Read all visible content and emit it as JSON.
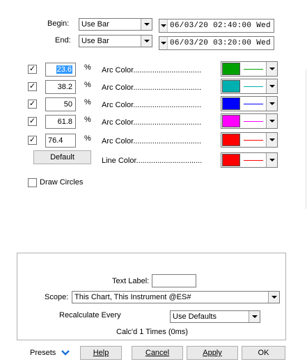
{
  "time_range": {
    "begin_label": "Begin:",
    "end_label": "End:",
    "begin_value": "Use Bar",
    "end_value": "Use Bar",
    "begin_datetime": "06/03/20 02:40:00 Wed",
    "end_datetime": "06/03/20 03:20:00 Wed"
  },
  "levels": [
    {
      "checked": true,
      "value": "23.6",
      "pct": "%",
      "label": "Arc Color................................",
      "color": "#00a000",
      "line_color": "#00a000"
    },
    {
      "checked": true,
      "value": "38.2",
      "pct": "%",
      "label": "Arc Color................................",
      "color": "#00b0b0",
      "line_color": "#00b0b0"
    },
    {
      "checked": true,
      "value": "50",
      "pct": "%",
      "label": "Arc Color................................",
      "color": "#0000ff",
      "line_color": "#0000ff"
    },
    {
      "checked": true,
      "value": "61.8",
      "pct": "%",
      "label": "Arc Color................................",
      "color": "#ff00ff",
      "line_color": "#ff00ff"
    },
    {
      "checked": true,
      "value": "76.4",
      "pct": "%",
      "label": "Arc Color................................",
      "color": "#ff0000",
      "line_color": "#ff0000"
    }
  ],
  "default_button": "Default",
  "line_color": {
    "label": "Line Color...............................",
    "color": "#ff0000",
    "line_color": "#ff0000"
  },
  "draw_circles": {
    "checked": false,
    "label": "Draw Circles"
  },
  "footer": {
    "text_label": "Text Label:",
    "text_value": "",
    "scope_label": "Scope:",
    "scope_value": "This Chart, This Instrument @ES#",
    "recalc_label": "Recalculate Every",
    "recalc_value": "Use Defaults",
    "calc_status": "Calc'd 1 Times (0ms)"
  },
  "buttons": {
    "presets": "Presets",
    "help": "Help",
    "cancel": "Cancel",
    "apply": "Apply",
    "ok": "OK"
  },
  "check_glyph": "✓"
}
